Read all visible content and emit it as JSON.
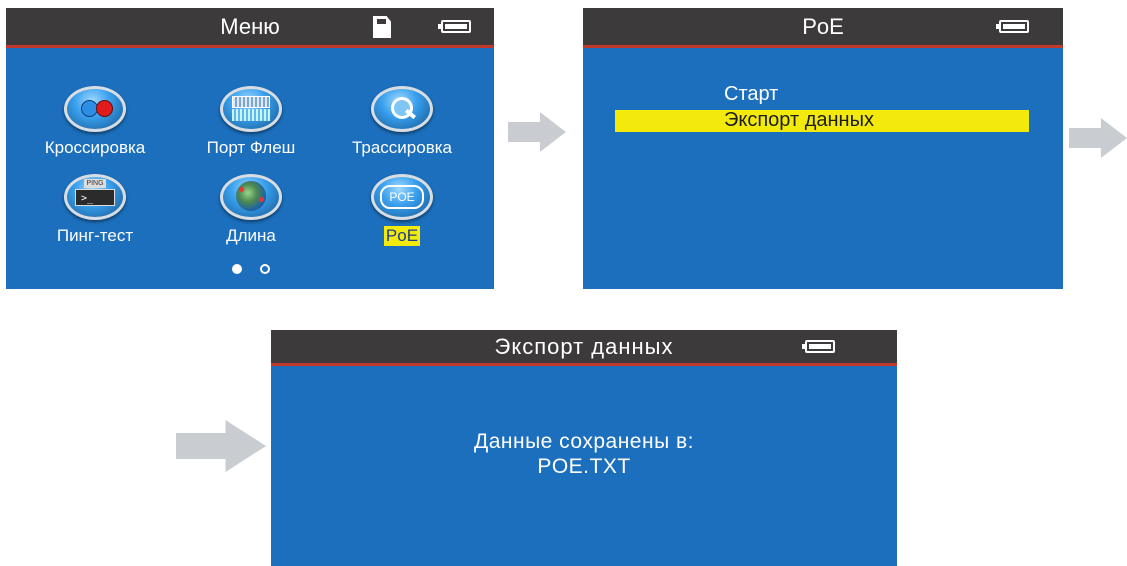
{
  "screen_menu": {
    "title": "Меню",
    "sdcard_icon": "sd-card-icon",
    "battery_icon": "battery-full-icon",
    "apps": [
      {
        "label": "Кроссировка",
        "icon": "wiremap-icon"
      },
      {
        "label": "Порт Флеш",
        "icon": "port-flash-icon"
      },
      {
        "label": "Трассировка",
        "icon": "trace-magnifier-icon"
      },
      {
        "label": "Пинг-тест",
        "icon": "ping-terminal-icon",
        "icon_text": "PING"
      },
      {
        "label": "Длина",
        "icon": "globe-length-icon"
      },
      {
        "label": "PoE",
        "icon": "poe-icon",
        "icon_text": "POE",
        "selected": true
      }
    ],
    "pages": {
      "count": 2,
      "current": 1
    }
  },
  "screen_poe": {
    "title": "PoE",
    "battery_icon": "battery-full-icon",
    "items": [
      {
        "label": "Старт",
        "selected": false
      },
      {
        "label": "Экспорт данных",
        "selected": true
      }
    ]
  },
  "screen_export": {
    "title": "Экспорт данных",
    "battery_icon": "battery-full-icon",
    "message_line1": "Данные сохранены в:",
    "message_line2": "POE.TXT"
  },
  "colors": {
    "screen_bg": "#1c6fbd",
    "titlebar_bg": "#3c3a3a",
    "titlebar_accent": "#c0392b",
    "highlight": "#f3ea0c",
    "arrow": "#c9ccd0"
  }
}
